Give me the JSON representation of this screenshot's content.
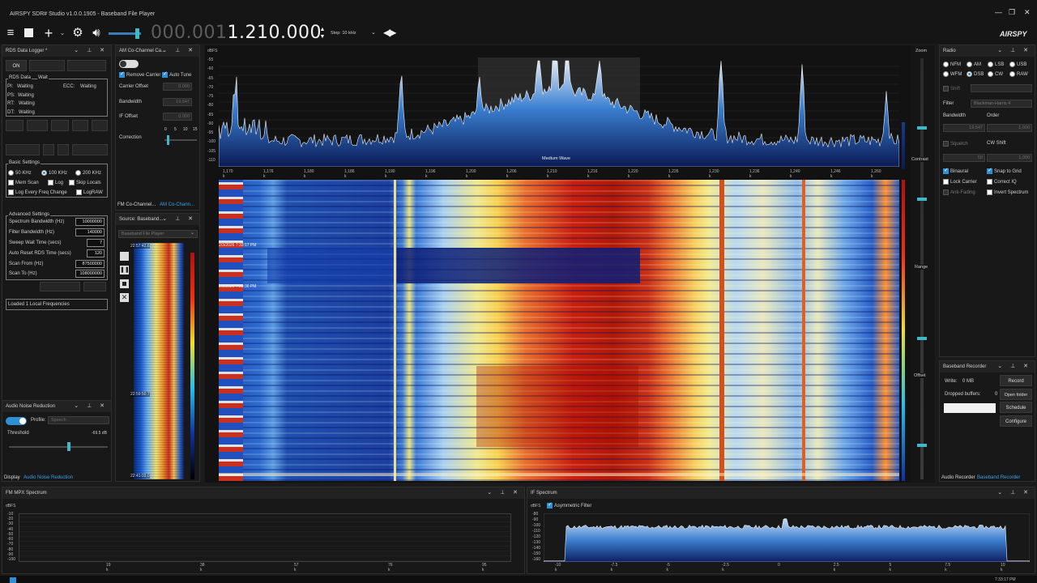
{
  "window": {
    "title": "AIRSPY SDR# Studio v1.0.0.1905 - Baseband File Player",
    "controls": [
      "—",
      "❐",
      "✕"
    ]
  },
  "toolbar": {
    "freq_dim": "000.001",
    "freq_bright": "1.210.000",
    "step_label": "Step: 10 kHz",
    "icons": [
      "menu-icon",
      "stop-icon",
      "add-icon",
      "gear-icon",
      "speaker-icon"
    ]
  },
  "rds_logger": {
    "title": "RDS Data Logger *",
    "on_button": "ON",
    "group_title": "RDS Data",
    "group_wait": "Wait",
    "pi_label": "PI:",
    "pi_value": "Waiting",
    "ecc_label": "ECC:",
    "ecc_value": "Waiting",
    "ps_label": "PS:",
    "ps_value": "Waiting",
    "rt_label": "RT:",
    "rt_value": "Waiting",
    "dt_label": "DT:",
    "dt_value": "Waiting",
    "basic_settings": "Basic Settings",
    "step_50": "50 KHz",
    "step_100": "100 KHz",
    "step_200": "200 KHz",
    "mem_scan": "Mem Scan",
    "log": "Log",
    "skip_locals": "Skip Locals",
    "log_every": "Log Every Freq Change",
    "lograw": "LogRAW",
    "advanced_settings": "Advanced Settings",
    "spectrum_bw_label": "Spectrum Bandwidth (Hz)",
    "spectrum_bw_value": "10000000",
    "filter_bw_label": "Filter Bandwidth (Hz)",
    "filter_bw_value": "140000",
    "sweep_wait_label": "Sweep Wait Time (secs)",
    "sweep_wait_value": "7",
    "auto_reset_label": "Auto Reset RDS Time (secs)",
    "auto_reset_value": "120",
    "scan_from_label": "Scan From (Hz)",
    "scan_from_value": "87500000",
    "scan_to_label": "Scan To (Hz)",
    "scan_to_value": "108000000",
    "status": "Loaded 1 Local Frequencies"
  },
  "am_cochannel": {
    "title": "AM Co-Channel Ca...",
    "remove_carrier": "Remove Carrier",
    "auto_tune": "Auto Tune",
    "carrier_offset_label": "Carrier Offset",
    "carrier_offset_value": "0.000",
    "bandwidth_label": "Bandwidth",
    "bandwidth_value": "19.547",
    "if_offset_label": "IF Offset",
    "if_offset_value": "0.000",
    "correction_label": "Correction",
    "correction_ticks": [
      "0",
      "5",
      "10",
      "15"
    ],
    "tab1": "FM Co-Channel...",
    "tab2": "AM Co-Chann..."
  },
  "source": {
    "title": "Source: Baseband...",
    "select": "Baseband File Player",
    "timestamps": [
      "22:57:42.6",
      "22:59:50.7",
      "22:41:03.0"
    ]
  },
  "noise_reduction": {
    "title": "Audio Noise Reduction",
    "profile_label": "Profile:",
    "profile_value": "Speech",
    "threshold_label": "Threshold",
    "threshold_value": "-69.5 dB",
    "tab1": "Display",
    "tab2": "Audio Noise Reduction"
  },
  "spectrum": {
    "ylabel": "dBFS",
    "y_ticks": [
      "-55",
      "-60",
      "-65",
      "-70",
      "-75",
      "-80",
      "-85",
      "-90",
      "-95",
      "-100",
      "-105",
      "-110"
    ],
    "x_ticks": [
      "1,170 k",
      "1,176 k",
      "1,180 k",
      "1,186 k",
      "1,190 k",
      "1,196 k",
      "1,200 k",
      "1,206 k",
      "1,210 k",
      "1,216 k",
      "1,220 k",
      "1,226 k",
      "1,230 k",
      "1,236 k",
      "1,240 k",
      "1,246 k",
      "1,260 k"
    ],
    "band_label": "Medium Wave",
    "wf_times": [
      "2/3/2026 7:33:17 PM",
      "2/3/2026 7:33:36 PM"
    ]
  },
  "zoom_panel": {
    "zoom": "Zoom",
    "contrast": "Contrast",
    "range": "Range",
    "offset": "Offset"
  },
  "radio": {
    "title": "Radio",
    "modes": [
      "NFM",
      "AM",
      "LSB",
      "USB",
      "WFM",
      "DSB",
      "CW",
      "RAW"
    ],
    "selected_mode": "DSB",
    "shift": "Shift",
    "filter_label": "Filter",
    "filter_value": "Blackman-Harris 4",
    "bandwidth_label": "Bandwidth",
    "order_label": "Order",
    "bandwidth_value": "19,547",
    "order_value": "1,000",
    "squelch": "Squelch",
    "cw_shift": "CW Shift",
    "squelch_value": "50",
    "cw_value": "1,000",
    "binaural": "Binaural",
    "snap_to_grid": "Snap to Grid",
    "lock_carrier": "Lock Carrier",
    "correct_iq": "Correct IQ",
    "anti_fading": "Anti-Fading",
    "invert_spectrum": "Invert Spectrum"
  },
  "recorder": {
    "title": "Baseband Recorder",
    "write_label": "Write:",
    "write_value": "0 MB",
    "dropped_label": "Dropped buffers:",
    "dropped_value": "0",
    "record": "Record",
    "open_folder": "Open folder",
    "schedule": "Schedule",
    "configure": "Configure",
    "tab1": "Audio Recorder",
    "tab2": "Baseband Recorder"
  },
  "mpx": {
    "title": "FM MPX Spectrum",
    "ylabel": "dBFS",
    "y_ticks": [
      "-10",
      "-20",
      "-30",
      "-40",
      "-50",
      "-60",
      "-70",
      "-80",
      "-90",
      "-100"
    ],
    "x_ticks": [
      "19 k",
      "38 k",
      "57 k",
      "76 k",
      "95 k"
    ]
  },
  "if_spectrum": {
    "title": "IF Spectrum",
    "ylabel": "dBFS",
    "asym_filter": "Asymmetric Filter",
    "y_ticks": [
      "-80",
      "-90",
      "-100",
      "-110",
      "-120",
      "-130",
      "-140",
      "-150",
      "-160"
    ],
    "x_ticks": [
      "-10 k",
      "-7.5 k",
      "-5 k",
      "-2.5 k",
      "0",
      "2.5 k",
      "5 k",
      "7.5 k",
      "10 k"
    ]
  },
  "taskbar": {
    "clock": "7:33:17 PM"
  }
}
